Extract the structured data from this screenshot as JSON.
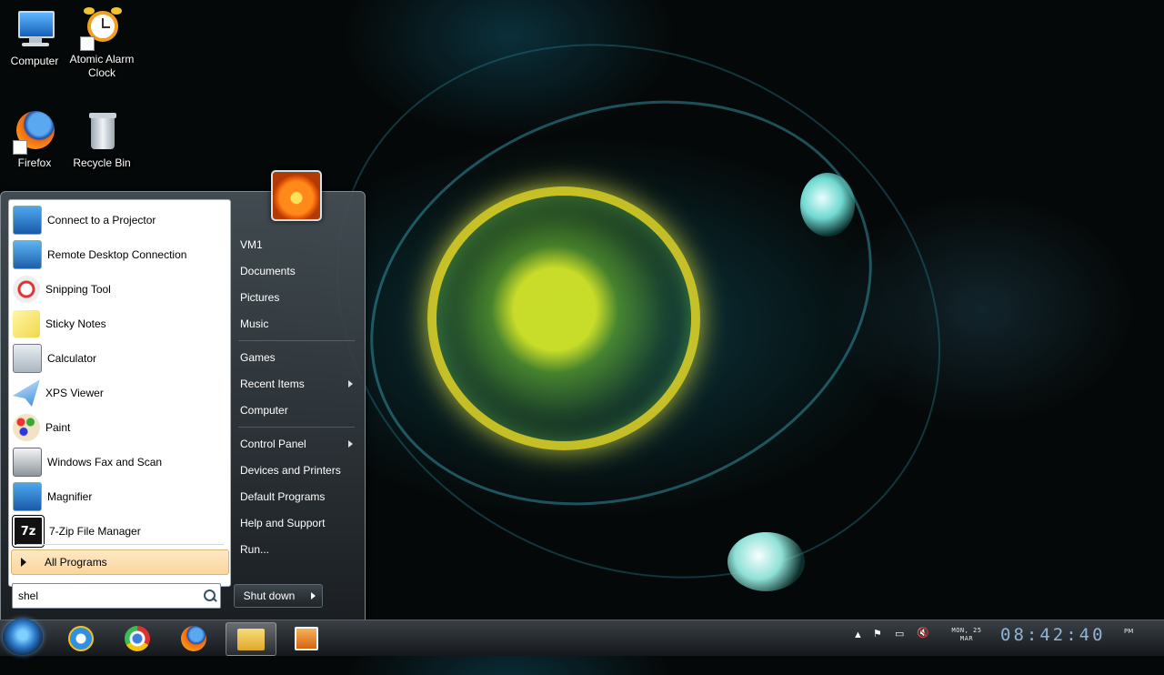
{
  "desktop": {
    "icons": [
      {
        "label": "Computer"
      },
      {
        "label": "Atomic Alarm Clock"
      },
      {
        "label": "Firefox"
      },
      {
        "label": "Recycle Bin"
      }
    ]
  },
  "start_menu": {
    "programs": [
      {
        "label": "Connect to a Projector",
        "icon": "projector-icon"
      },
      {
        "label": "Remote Desktop Connection",
        "icon": "remote-desktop-icon"
      },
      {
        "label": "Snipping Tool",
        "icon": "scissors-icon"
      },
      {
        "label": "Sticky Notes",
        "icon": "sticky-note-icon"
      },
      {
        "label": "Calculator",
        "icon": "calculator-icon"
      },
      {
        "label": "XPS Viewer",
        "icon": "paper-plane-icon"
      },
      {
        "label": "Paint",
        "icon": "palette-icon"
      },
      {
        "label": "Windows Fax and Scan",
        "icon": "fax-icon"
      },
      {
        "label": "Magnifier",
        "icon": "magnifier-icon"
      },
      {
        "label": "7-Zip File Manager",
        "icon": "7zip-icon"
      }
    ],
    "all_programs": "All Programs",
    "search": {
      "value": "shel"
    },
    "right_items": {
      "user": "VM1",
      "documents": "Documents",
      "pictures": "Pictures",
      "music": "Music",
      "games": "Games",
      "recent": "Recent Items",
      "computer": "Computer",
      "control_panel": "Control Panel",
      "devices": "Devices and Printers",
      "default_programs": "Default Programs",
      "help": "Help and Support",
      "run": "Run..."
    },
    "shutdown": "Shut down"
  },
  "taskbar": {
    "pinned": [
      "start-orb",
      "internet-explorer-icon",
      "chrome-icon",
      "firefox-icon",
      "windows-explorer-icon",
      "media-player-icon"
    ],
    "clock": {
      "day": "MON, 25",
      "month": "MAR",
      "time": "08:42:40",
      "ampm": "PM"
    }
  },
  "colors": {
    "accent": "#fbd69c",
    "clock": "#8fb4d8"
  }
}
